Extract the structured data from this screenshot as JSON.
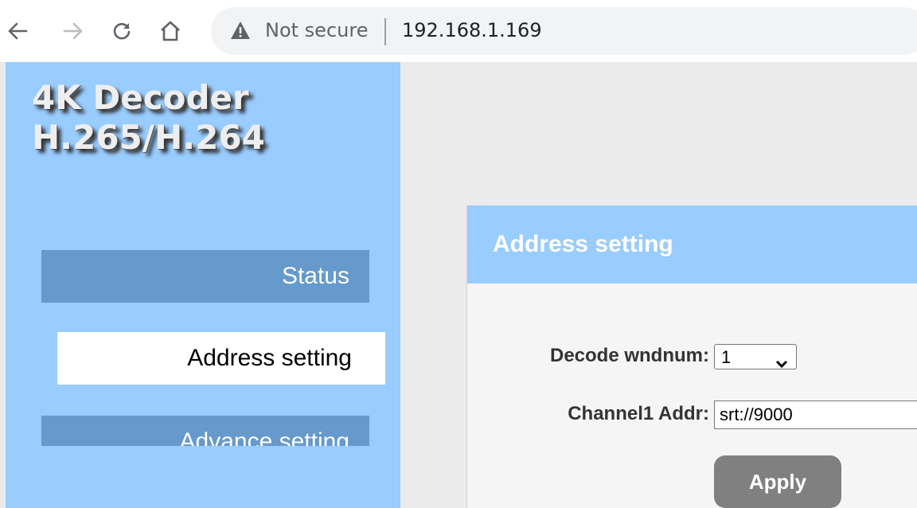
{
  "browser": {
    "security_label": "Not secure",
    "url": "192.168.1.169",
    "icons": [
      "back-arrow-icon",
      "forward-arrow-icon",
      "reload-icon",
      "home-icon",
      "warning-icon"
    ]
  },
  "sidebar": {
    "brand_line1": "4K Decoder",
    "brand_line2": "H.265/H.264",
    "items": [
      {
        "label": "Status"
      },
      {
        "label": "Address setting"
      },
      {
        "label": "Advance setting"
      }
    ]
  },
  "panel": {
    "title": "Address setting",
    "wndnum_label": "Decode wndnum:",
    "wndnum_value": "1",
    "channel1_label": "Channel1 Addr:",
    "channel1_value": "srt://9000",
    "apply_label": "Apply"
  },
  "colors": {
    "sidebar_bg": "#99ccff",
    "menu_item_bg": "#6699cc",
    "active_item_bg": "#ffffff",
    "button_bg": "#808080",
    "page_bg": "#ebebeb"
  }
}
